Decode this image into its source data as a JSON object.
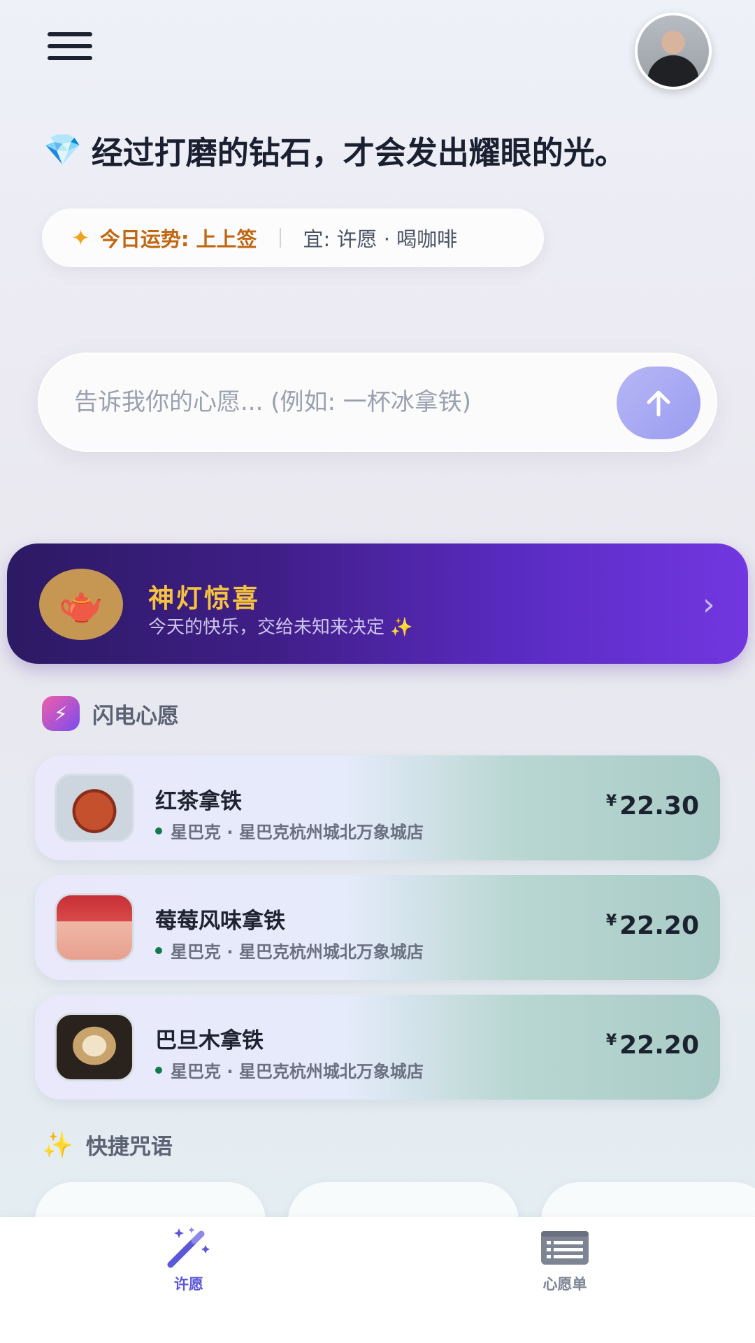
{
  "header": {
    "menu_icon": "hamburger-menu-icon",
    "avatar": "user-avatar"
  },
  "quote": {
    "icon": "diamond-icon",
    "emoji": "💎",
    "text": "经过打磨的钻石，才会发出耀眼的光。"
  },
  "fortune": {
    "icon": "sparkle-icon",
    "glyph": "✦",
    "luck": "今日运势: 上上签",
    "suitable": "宜: 许愿 · 喝咖啡"
  },
  "wish": {
    "placeholder": "告诉我你的心愿... (例如: 一杯冰拿铁)",
    "value": "",
    "send_icon": "arrow-up-icon"
  },
  "lamp_banner": {
    "icon": "teapot-icon",
    "emoji": "🫖",
    "title": "神灯惊喜",
    "subtitle": "今天的快乐，交给未知来决定 ✨",
    "arrow": "›"
  },
  "flash_wishes": {
    "title": "闪电心愿",
    "icon": "lightning-icon",
    "glyph": "⚡",
    "items": [
      {
        "name": "红茶拿铁",
        "store": "星巴克 · 星巴克杭州城北万象城店",
        "currency": "¥",
        "price": "22.30"
      },
      {
        "name": "莓莓风味拿铁",
        "store": "星巴克 · 星巴克杭州城北万象城店",
        "currency": "¥",
        "price": "22.20"
      },
      {
        "name": "巴旦木拿铁",
        "store": "星巴克 · 星巴克杭州城北万象城店",
        "currency": "¥",
        "price": "22.20"
      }
    ]
  },
  "quick_spells": {
    "title": "快捷咒语",
    "icon": "sparkles-icon",
    "glyph": "✨"
  },
  "tabbar": {
    "tabs": [
      {
        "label": "许愿",
        "icon": "magic-wand-icon",
        "active": true
      },
      {
        "label": "心愿单",
        "icon": "list-icon",
        "active": false
      }
    ]
  },
  "colors": {
    "accent": "#5b57d6",
    "fortune_text": "#c2660f",
    "lamp_title": "#f6c341",
    "store_dot": "#127a4e"
  }
}
